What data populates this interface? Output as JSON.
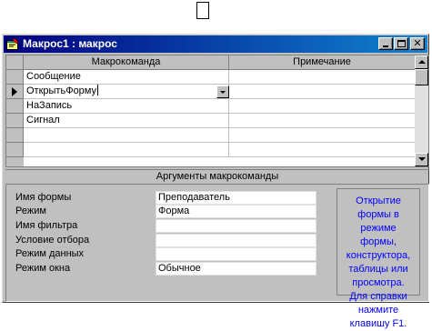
{
  "window": {
    "title": "Макрос1 : макрос",
    "close_glyph": "✕"
  },
  "grid": {
    "columns": [
      "Макрокоманда",
      "Примечание"
    ],
    "rows": [
      {
        "action": "Сообщение",
        "note": ""
      },
      {
        "action": "ОткрытьФорму",
        "note": ""
      },
      {
        "action": "НаЗапись",
        "note": ""
      },
      {
        "action": "Сигнал",
        "note": ""
      }
    ],
    "current_row": 1
  },
  "arguments": {
    "title": "Аргументы макрокоманды",
    "fields": [
      {
        "label": "Имя формы",
        "value": "Преподаватель"
      },
      {
        "label": "Режим",
        "value": "Форма"
      },
      {
        "label": "Имя фильтра",
        "value": ""
      },
      {
        "label": "Условие отбора",
        "value": ""
      },
      {
        "label": "Режим данных",
        "value": ""
      },
      {
        "label": "Режим окна",
        "value": "Обычное"
      }
    ],
    "help_lines": [
      "Открытие",
      "формы в",
      "режиме",
      "формы,",
      "конструктора,",
      "таблицы или",
      "просмотра.",
      "Для справки",
      "нажмите",
      "клавишу F1."
    ]
  },
  "colors": {
    "title_start": "#000080",
    "title_end": "#1084d0",
    "help_text": "#0000ff",
    "face": "#c0c0c0"
  },
  "icons": {
    "app": "macro-icon",
    "minimize": "minimize-icon",
    "maximize": "maximize-icon",
    "close": "close-icon",
    "row_pointer": "current-row-arrow-icon",
    "dropdown": "chevron-down-icon"
  }
}
